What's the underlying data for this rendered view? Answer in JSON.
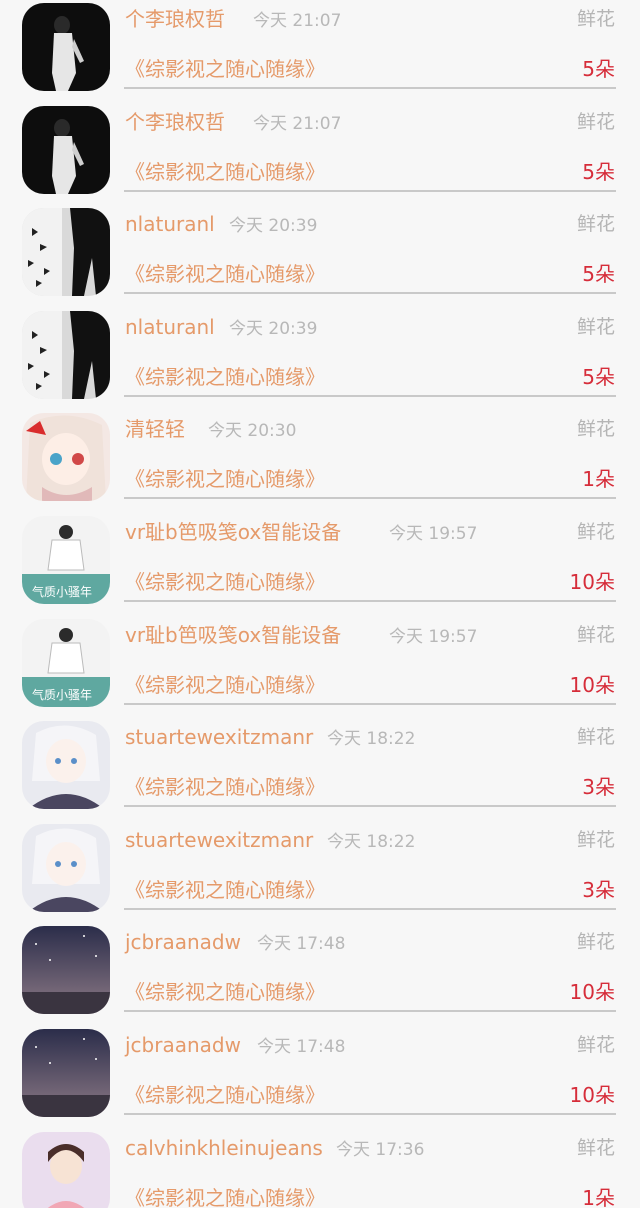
{
  "items": [
    {
      "username": "个李琅权哲",
      "time": "今天 21:07",
      "gift": "鲜花",
      "work": "《综影视之随心随缘》",
      "count": "5朵",
      "avatar_icon": "dark-figure-avatar-icon"
    },
    {
      "username": "个李琅权哲",
      "time": "今天 21:07",
      "gift": "鲜花",
      "work": "《综影视之随心随缘》",
      "count": "5朵",
      "avatar_icon": "dark-figure-avatar-icon"
    },
    {
      "username": "nlaturanl",
      "time": "今天 20:39",
      "gift": "鲜花",
      "work": "《综影视之随心随缘》",
      "count": "5朵",
      "avatar_icon": "butterflies-avatar-icon"
    },
    {
      "username": "nlaturanl",
      "time": "今天 20:39",
      "gift": "鲜花",
      "work": "《综影视之随心随缘》",
      "count": "5朵",
      "avatar_icon": "butterflies-avatar-icon"
    },
    {
      "username": "清轻轻",
      "time": "今天 20:30",
      "gift": "鲜花",
      "work": "《综影视之随心随缘》",
      "count": "1朵",
      "avatar_icon": "anime-girl-avatar-icon"
    },
    {
      "username": "vr耻b笆吸笺ox智能设备",
      "time": "今天 19:57",
      "gift": "鲜花",
      "work": "《综影视之随心随缘》",
      "count": "10朵",
      "avatar_icon": "fashion-avatar-icon"
    },
    {
      "username": "vr耻b笆吸笺ox智能设备",
      "time": "今天 19:57",
      "gift": "鲜花",
      "work": "《综影视之随心随缘》",
      "count": "10朵",
      "avatar_icon": "fashion-avatar-icon"
    },
    {
      "username": "stuartewexitzmanr",
      "time": "今天 18:22",
      "gift": "鲜花",
      "work": "《综影视之随心随缘》",
      "count": "3朵",
      "avatar_icon": "anime-boy-avatar-icon"
    },
    {
      "username": "stuartewexitzmanr",
      "time": "今天 18:22",
      "gift": "鲜花",
      "work": "《综影视之随心随缘》",
      "count": "3朵",
      "avatar_icon": "anime-boy-avatar-icon"
    },
    {
      "username": "jcbraanadw",
      "time": "今天 17:48",
      "gift": "鲜花",
      "work": "《综影视之随心随缘》",
      "count": "10朵",
      "avatar_icon": "night-sky-avatar-icon"
    },
    {
      "username": "jcbraanadw",
      "time": "今天 17:48",
      "gift": "鲜花",
      "work": "《综影视之随心随缘》",
      "count": "10朵",
      "avatar_icon": "night-sky-avatar-icon"
    },
    {
      "username": "calvhinkhleinujeans",
      "time": "今天 17:36",
      "gift": "鲜花",
      "work": "《综影视之随心随缘》",
      "count": "1朵",
      "avatar_icon": "cartoon-girl-avatar-icon"
    }
  ]
}
